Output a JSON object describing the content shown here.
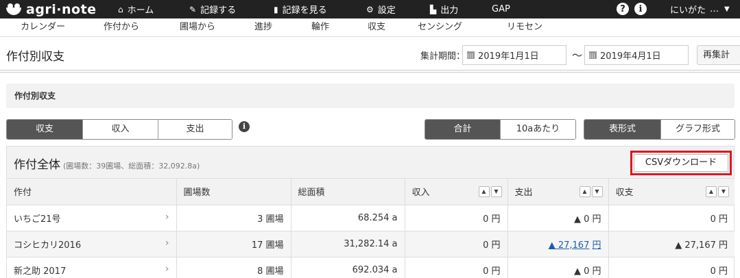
{
  "app": {
    "logo": "agri·note"
  },
  "topnav": [
    {
      "icon": "home-icon",
      "label": "ホーム"
    },
    {
      "icon": "pencil-icon",
      "label": "記録する"
    },
    {
      "icon": "book-icon",
      "label": "記録を見る"
    },
    {
      "icon": "gear-icon",
      "label": "設定"
    },
    {
      "icon": "file-icon",
      "label": "出力"
    },
    {
      "icon": "",
      "label": "GAP"
    }
  ],
  "header_icons": {
    "help": "?",
    "info": "i"
  },
  "user": {
    "name": "にいがた",
    "ellipsis": "…"
  },
  "subnav": [
    "カレンダー",
    "作付から",
    "圃場から",
    "進捗",
    "輪作",
    "収支",
    "センシング",
    "リモセン"
  ],
  "page": {
    "title": "作付別収支",
    "period_label": "集計期間：",
    "date_from": "2019年1月1日",
    "tilde": "〜",
    "date_to": "2019年4月1日",
    "recalc_label": "再集計",
    "section_title": "作付別収支"
  },
  "filters": {
    "type_group": [
      "収支",
      "収入",
      "支出"
    ],
    "type_active": "収支",
    "unit_group": [
      "合計",
      "10aあたり"
    ],
    "unit_active": "合計",
    "view_group": [
      "表形式",
      "グラフ形式"
    ],
    "view_active": "表形式",
    "info_icon": "i"
  },
  "panel": {
    "title": "作付全体",
    "subtitle": "(圃場数：39圃場、総面積：32,092.8a)",
    "csv_label": "CSVダウンロード",
    "columns": [
      "作付",
      "圃場数",
      "総面積",
      "収入",
      "支出",
      "収支"
    ],
    "sort_up": "▲",
    "sort_down": "▼",
    "rows": [
      {
        "crop": "いちご21号",
        "fields": "3 圃場",
        "area": "68.254 a",
        "income": "0 円",
        "expense": "▲ 0 円",
        "balance": "0 円"
      },
      {
        "crop": "コシヒカリ2016",
        "fields": "17 圃場",
        "area": "31,282.14 a",
        "income": "0 円",
        "expense_value": "▲ 27,167",
        "expense_unit": "円",
        "balance": "▲ 27,167 円"
      },
      {
        "crop": "新之助 2017",
        "fields": "8 圃場",
        "area": "692.034 a",
        "income": "0 円",
        "expense": "▲ 0 円",
        "balance": "0 円"
      }
    ]
  },
  "colors": {
    "topbar": "#222222",
    "active_button": "#555555",
    "highlight": "#e0151f",
    "link": "#1a5fa8"
  }
}
